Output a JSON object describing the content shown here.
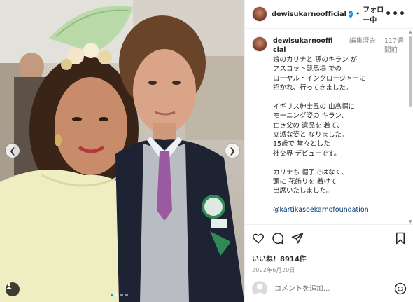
{
  "post": {
    "username": "dewisukarnoofficial",
    "separator": "•",
    "follow_state": "フォロー中",
    "more": "•••"
  },
  "caption": {
    "username": "dewisukarnoofficial",
    "edited": "編集済み",
    "time": "117週間前",
    "lines": [
      "娘のカリナと 孫のキラン が",
      "アスコット競馬場 での",
      "ローヤル・インクロージャーに",
      "招かれ、行ってきました。",
      "",
      "イギリス紳士風の 山高帽に",
      "モーニング姿の キラン、",
      "亡き父の 遺品を 着て、",
      "立派な姿と なりました。",
      "15歳で 堂々とした",
      "社交界 デビューです。",
      "",
      "カリナも 帽子ではなく、",
      "頭に 花飾りを 着けて",
      "出席いたしました。",
      ""
    ],
    "mention": "@kartikasoekarnofoundation"
  },
  "engagement": {
    "likes": "いいね！8914件",
    "date": "2022年6月20日"
  },
  "comment_box": {
    "placeholder": "コメントを追加..."
  },
  "icons": {
    "verified": "verified-badge-icon",
    "like": "heart-icon",
    "comment": "comment-icon",
    "share": "paper-plane-icon",
    "save": "bookmark-icon",
    "emoji": "emoji-icon",
    "prev": "chevron-left-icon",
    "next": "chevron-right-icon",
    "tags": "user-tag-icon"
  },
  "carousel": {
    "slide_count": 4,
    "active_index": 0
  },
  "colors": {
    "accent": "#0095f6",
    "text": "#262626",
    "muted": "#8e8e8e",
    "link": "#00376b"
  }
}
